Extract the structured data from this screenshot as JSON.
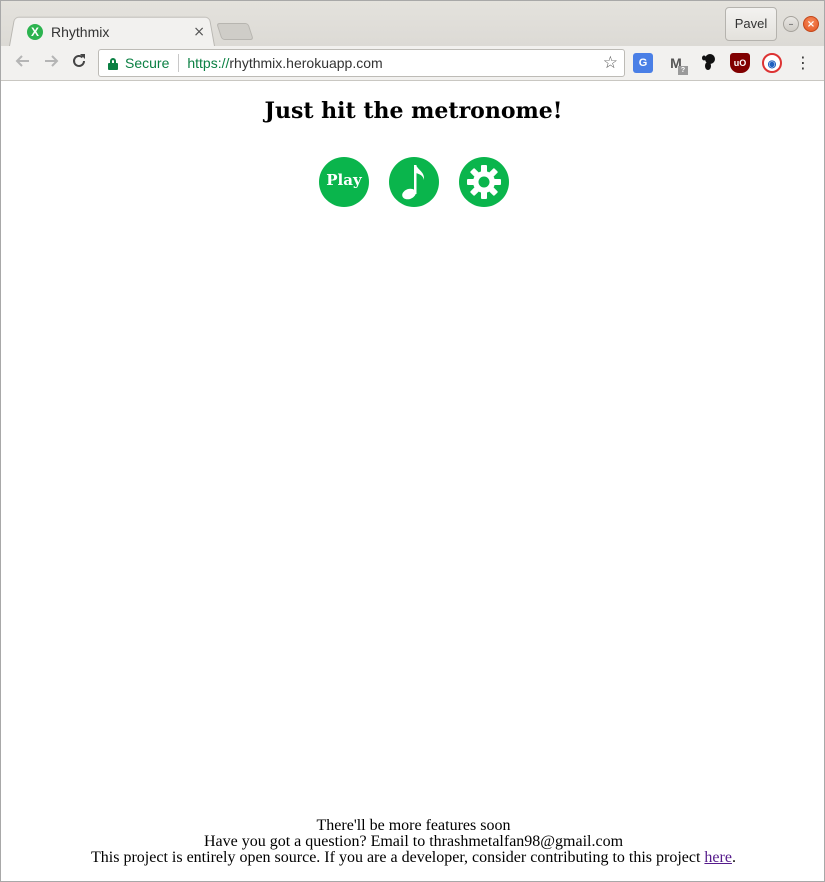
{
  "browser": {
    "tab_title": "Rhythmix",
    "tab_close": "×",
    "profile_name": "Pavel",
    "security_label": "Secure",
    "url_scheme": "https://",
    "url_host": "rhythmix.herokuapp.com",
    "extensions": [
      "google-translate-icon",
      "gmail-checker-icon",
      "gnome-icon",
      "ublock-icon",
      "grid-extension-icon"
    ]
  },
  "page": {
    "heading": "Just hit the metronome!",
    "play_label": "Play",
    "footer_line1": "There'll be more features soon",
    "footer_line2": "Have you got a question? Email to thrashmetalfan98@gmail.com",
    "footer_line3_text": "This project is entirely open source. If you are a developer, consider contributing to this project ",
    "footer_link": "here",
    "footer_line3_end": "."
  },
  "colors": {
    "accent_green": "#0ab54c",
    "secure_green": "#0b8043",
    "visited_link": "#551a8b"
  }
}
